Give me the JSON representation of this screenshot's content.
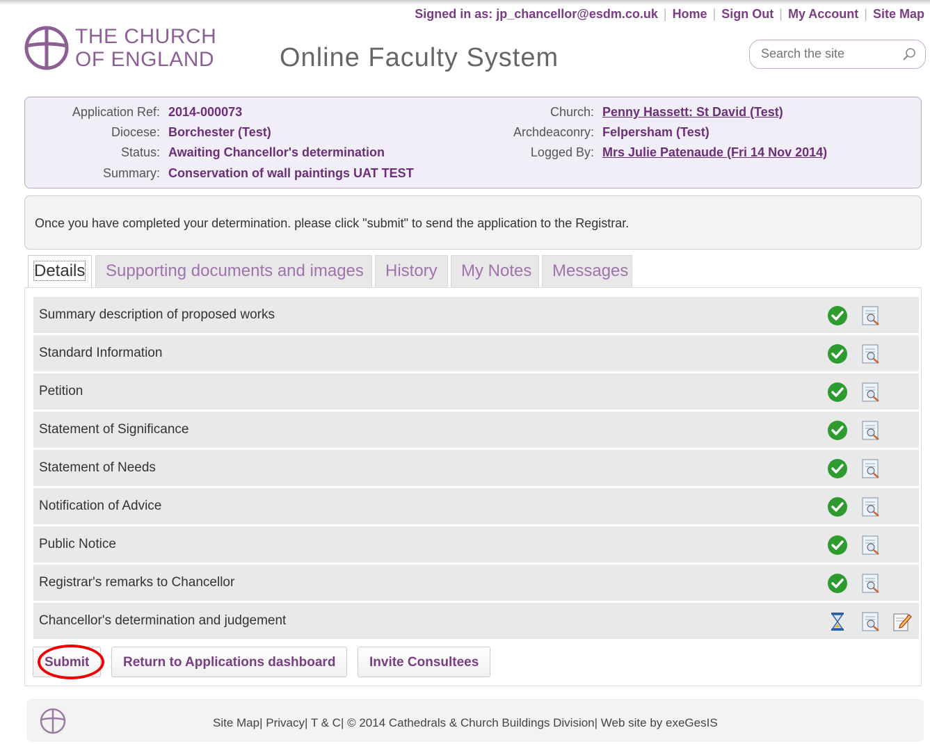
{
  "topnav": {
    "signed_in": "Signed in as: jp_chancellor@esdm.co.uk",
    "home": "Home",
    "sign_out": "Sign Out",
    "my_account": "My Account",
    "site_map": "Site Map"
  },
  "brand": {
    "line1": "THE CHURCH",
    "line2": "OF ENGLAND",
    "title": "Online Faculty System"
  },
  "search": {
    "placeholder": "Search the site"
  },
  "application": {
    "ref_label": "Application Ref:",
    "ref": "2014-000073",
    "diocese_label": "Diocese:",
    "diocese": "Borchester (Test)",
    "status_label": "Status:",
    "status": "Awaiting Chancellor's determination",
    "summary_label": "Summary:",
    "summary": "Conservation of wall paintings UAT TEST",
    "church_label": "Church:",
    "church": "Penny Hassett: St David (Test)",
    "archdeaconry_label": "Archdeaconry:",
    "archdeaconry": "Felpersham (Test)",
    "logged_by_label": "Logged By:",
    "logged_by": "Mrs Julie Patenaude (Fri 14 Nov 2014)"
  },
  "notice": "Once you have completed your determination. please click \"submit\" to send the application to the Registrar.",
  "tabs": [
    {
      "label": "Details"
    },
    {
      "label": "Supporting documents and images"
    },
    {
      "label": "History"
    },
    {
      "label": "My Notes"
    },
    {
      "label": "Messages"
    }
  ],
  "sections": [
    {
      "label": "Summary description of proposed works",
      "status": "complete"
    },
    {
      "label": "Standard Information",
      "status": "complete"
    },
    {
      "label": "Petition",
      "status": "complete"
    },
    {
      "label": "Statement of Significance",
      "status": "complete"
    },
    {
      "label": "Statement of Needs",
      "status": "complete"
    },
    {
      "label": "Notification of Advice",
      "status": "complete"
    },
    {
      "label": "Public Notice",
      "status": "complete"
    },
    {
      "label": "Registrar's remarks to Chancellor",
      "status": "complete"
    },
    {
      "label": "Chancellor's determination and judgement",
      "status": "pending"
    }
  ],
  "buttons": {
    "submit": "Submit",
    "return": "Return to Applications dashboard",
    "invite": "Invite Consultees"
  },
  "footer": {
    "site_map": "Site Map",
    "privacy": "Privacy",
    "tc": "T & C",
    "copyright": "© 2014 Cathedrals & Church Buildings Division",
    "credit": "Web site by exeGesIS"
  },
  "colors": {
    "accent": "#7a3d84",
    "info_bg": "#f1eef7",
    "check": "#2e9b2e",
    "highlight_ring": "#e00000"
  }
}
